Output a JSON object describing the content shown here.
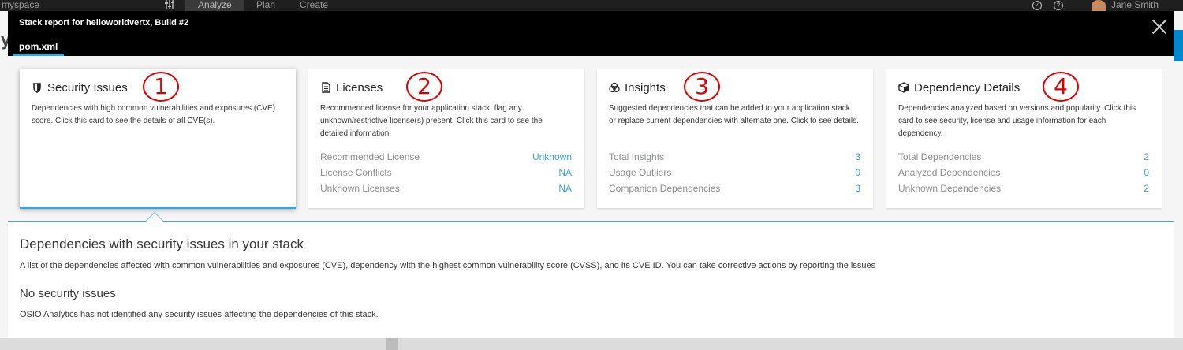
{
  "app_bar": {
    "space": "myspace",
    "nav": [
      "Analyze",
      "Plan",
      "Create"
    ],
    "user": "Jane Smith"
  },
  "modal": {
    "title": "Stack report for helloworldvertx, Build #2",
    "tab": "pom.xml"
  },
  "cards": [
    {
      "title": "Security Issues",
      "icon": "shield-icon",
      "annotation": "1",
      "description": "Dependencies with high common vulnerabilities and exposures (CVE) score. Click this card to see the details of all CVE(s).",
      "rows": []
    },
    {
      "title": "Licenses",
      "icon": "document-icon",
      "annotation": "2",
      "description": "Recommended license for your application stack, flag any unknown/restrictive license(s) present. Click this card to see the detailed information.",
      "rows": [
        {
          "label": "Recommended License",
          "value": "Unknown"
        },
        {
          "label": "License Conflicts",
          "value": "NA"
        },
        {
          "label": "Unknown Licenses",
          "value": "NA"
        }
      ]
    },
    {
      "title": "Insights",
      "icon": "insights-icon",
      "annotation": "3",
      "description": "Suggested dependencies that can be added to your application stack or replace current dependencies with alternate one. Click to see details.",
      "rows": [
        {
          "label": "Total Insights",
          "value": "3"
        },
        {
          "label": "Usage Outliers",
          "value": "0"
        },
        {
          "label": "Companion Dependencies",
          "value": "3"
        }
      ]
    },
    {
      "title": "Dependency Details",
      "icon": "cube-icon",
      "annotation": "4",
      "description": "Dependencies analyzed based on versions and popularity. Click this card to see security, license and usage information for each dependency.",
      "rows": [
        {
          "label": "Total Dependencies",
          "value": "2"
        },
        {
          "label": "Analyzed Dependencies",
          "value": "0"
        },
        {
          "label": "Unknown Dependencies",
          "value": "2"
        }
      ]
    }
  ],
  "details": {
    "title": "Dependencies with security issues in your stack",
    "description": "A list of the dependencies affected with common vulnerabilities and exposures (CVE), dependency with the highest common vulnerability score (CVSS), and its CVE ID. You can take corrective actions by reporting the issues",
    "subtitle": "No security issues",
    "message": "OSIO Analytics has not identified any security issues affecting the dependencies of this stack."
  },
  "colors": {
    "accent": "#39a5dc",
    "annotation": "#dd0000",
    "header": "#000000"
  }
}
